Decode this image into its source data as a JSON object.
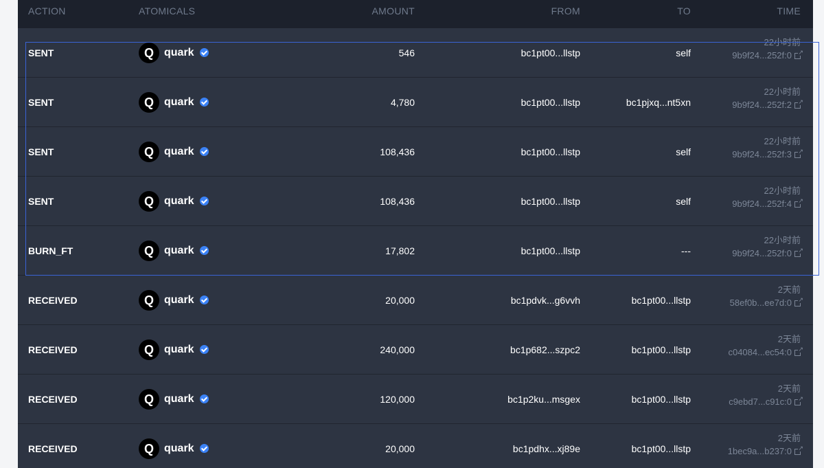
{
  "columns": {
    "action": "ACTION",
    "atomicals": "ATOMICALS",
    "amount": "AMOUNT",
    "from": "FROM",
    "to": "TO",
    "time": "TIME"
  },
  "colors": {
    "panel_bg": "#2d3442",
    "header_bg": "#1c212c",
    "verified": "#3b82f6",
    "selection": "#3a63d6"
  },
  "rows": [
    {
      "action": "SENT",
      "logo": "Q",
      "name": "quark",
      "amount": "546",
      "from": "bc1pt00...llstp",
      "to": "self",
      "time": "22小时前",
      "txid": "9b9f24...252f:0"
    },
    {
      "action": "SENT",
      "logo": "Q",
      "name": "quark",
      "amount": "4,780",
      "from": "bc1pt00...llstp",
      "to": "bc1pjxq...nt5xn",
      "time": "22小时前",
      "txid": "9b9f24...252f:2"
    },
    {
      "action": "SENT",
      "logo": "Q",
      "name": "quark",
      "amount": "108,436",
      "from": "bc1pt00...llstp",
      "to": "self",
      "time": "22小时前",
      "txid": "9b9f24...252f:3"
    },
    {
      "action": "SENT",
      "logo": "Q",
      "name": "quark",
      "amount": "108,436",
      "from": "bc1pt00...llstp",
      "to": "self",
      "time": "22小时前",
      "txid": "9b9f24...252f:4"
    },
    {
      "action": "BURN_FT",
      "logo": "Q",
      "name": "quark",
      "amount": "17,802",
      "from": "bc1pt00...llstp",
      "to": "---",
      "time": "22小时前",
      "txid": "9b9f24...252f:0"
    },
    {
      "action": "RECEIVED",
      "logo": "Q",
      "name": "quark",
      "amount": "20,000",
      "from": "bc1pdvk...g6vvh",
      "to": "bc1pt00...llstp",
      "time": "2天前",
      "txid": "58ef0b...ee7d:0"
    },
    {
      "action": "RECEIVED",
      "logo": "Q",
      "name": "quark",
      "amount": "240,000",
      "from": "bc1p682...szpc2",
      "to": "bc1pt00...llstp",
      "time": "2天前",
      "txid": "c04084...ec54:0"
    },
    {
      "action": "RECEIVED",
      "logo": "Q",
      "name": "quark",
      "amount": "120,000",
      "from": "bc1p2ku...msgex",
      "to": "bc1pt00...llstp",
      "time": "2天前",
      "txid": "c9ebd7...c91c:0"
    },
    {
      "action": "RECEIVED",
      "logo": "Q",
      "name": "quark",
      "amount": "20,000",
      "from": "bc1pdhx...xj89e",
      "to": "bc1pt00...llstp",
      "time": "2天前",
      "txid": "1bec9a...b237:0"
    }
  ],
  "icons": {
    "verified": "verified-badge-icon",
    "external": "external-link-icon"
  }
}
